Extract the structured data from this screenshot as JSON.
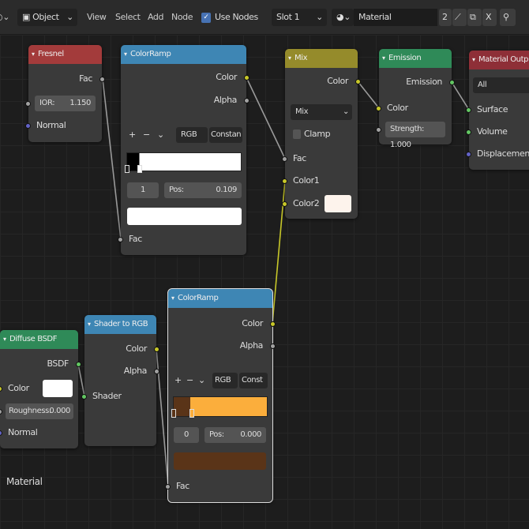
{
  "header": {
    "mode": "Object",
    "menus": [
      "View",
      "Select",
      "Add",
      "Node"
    ],
    "use_nodes_label": "Use Nodes",
    "use_nodes_checked": true,
    "slot": "Slot 1",
    "material_name": "Material",
    "user_count": "2",
    "close": "X"
  },
  "canvas_label": "Material",
  "nodes": {
    "fresnel": {
      "title": "Fresnel",
      "color": "#a33b3b",
      "out_fac": "Fac",
      "ior_label": "IOR:",
      "ior_value": "1.150",
      "in_normal": "Normal"
    },
    "colorramp1": {
      "title": "ColorRamp",
      "color": "#3e86b4",
      "out_color": "Color",
      "out_alpha": "Alpha",
      "plus": "+",
      "minus": "−",
      "chev": "⌄",
      "color_mode": "RGB",
      "interp": "Constan",
      "stop_index": "1",
      "pos_label": "Pos:",
      "pos_value": "0.109",
      "stop_color": "#ffffff",
      "ramp": [
        "#000000",
        "#ffffff"
      ],
      "in_fac": "Fac"
    },
    "mix": {
      "title": "Mix",
      "color": "#958b2b",
      "out_color": "Color",
      "blend": "Mix",
      "clamp_label": "Clamp",
      "clamp_checked": false,
      "in_fac": "Fac",
      "in_color1": "Color1",
      "in_color2": "Color2",
      "color2_value": "#fdf3ec"
    },
    "emission": {
      "title": "Emission",
      "color": "#2f8a58",
      "out_emission": "Emission",
      "in_color": "Color",
      "strength_label": "Strength:",
      "strength_value": "1.000"
    },
    "output": {
      "title": "Material Output",
      "color": "#8e2f37",
      "target": "All",
      "in_surface": "Surface",
      "in_volume": "Volume",
      "in_displacement": "Displacement"
    },
    "diffuse": {
      "title": "Diffuse BSDF",
      "color": "#2f8a58",
      "out_bsdf": "BSDF",
      "in_color": "Color",
      "color_value": "#ffffff",
      "roughness_label": "Roughness:",
      "roughness_value": "0.000",
      "in_normal": "Normal"
    },
    "shader_to_rgb": {
      "title": "Shader to RGB",
      "color": "#3e86b4",
      "out_color": "Color",
      "out_alpha": "Alpha",
      "in_shader": "Shader"
    },
    "colorramp2": {
      "title": "ColorRamp",
      "color": "#3e86b4",
      "out_color": "Color",
      "out_alpha": "Alpha",
      "plus": "+",
      "minus": "−",
      "chev": "⌄",
      "color_mode": "RGB",
      "interp": "Const",
      "stop_index": "0",
      "pos_label": "Pos:",
      "pos_value": "0.000",
      "stop_color": "#5a3418",
      "ramp": [
        "#5a3418",
        "#fbae3c"
      ],
      "in_fac": "Fac"
    }
  }
}
